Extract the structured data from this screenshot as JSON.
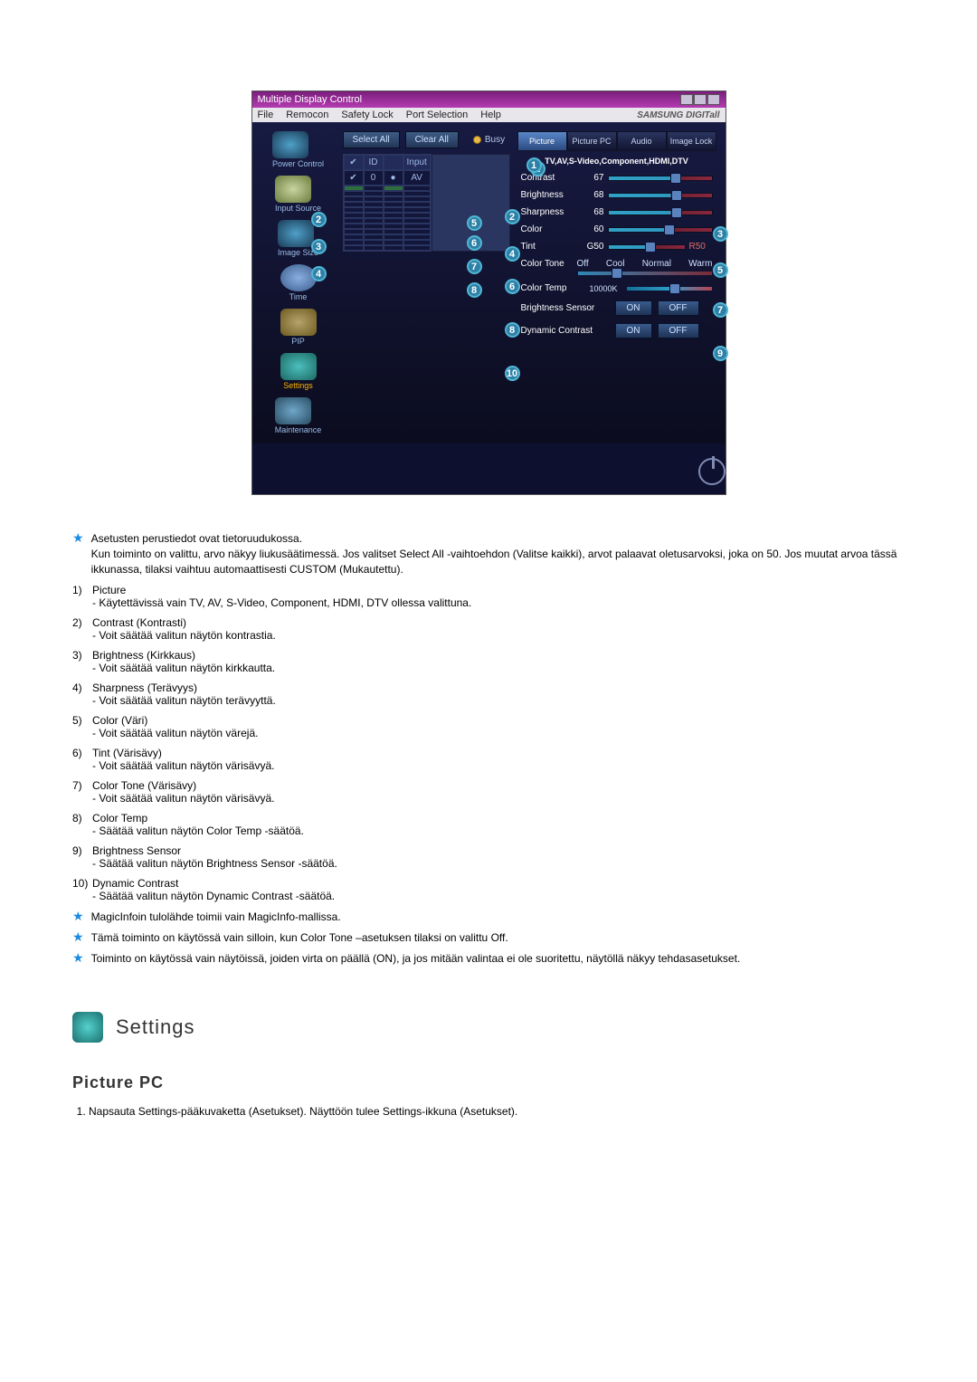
{
  "window": {
    "title": "Multiple Display Control",
    "menus": [
      "File",
      "Remocon",
      "Safety Lock",
      "Port Selection",
      "Help"
    ],
    "brand": "SAMSUNG DIGITall"
  },
  "sidebar": {
    "items": [
      {
        "label": "Power Control"
      },
      {
        "label": "Input Source"
      },
      {
        "label": "Image Size"
      },
      {
        "label": "Time"
      },
      {
        "label": "PIP"
      },
      {
        "label": "Settings",
        "active": true
      },
      {
        "label": "Maintenance"
      }
    ]
  },
  "mid": {
    "select_all": "Select All",
    "clear_all": "Clear All",
    "busy": "Busy",
    "head": {
      "chk": "✔",
      "id": "ID",
      "stat": "",
      "input": "Input"
    },
    "rows": [
      {
        "chk": "✔",
        "id": "0",
        "stat": "●",
        "input": "AV"
      },
      {
        "chk": "",
        "id": "",
        "stat": "",
        "input": ""
      },
      {
        "chk": "",
        "id": "",
        "stat": "",
        "input": ""
      },
      {
        "chk": "",
        "id": "",
        "stat": "",
        "input": ""
      },
      {
        "chk": "",
        "id": "",
        "stat": "",
        "input": ""
      },
      {
        "chk": "",
        "id": "",
        "stat": "",
        "input": ""
      },
      {
        "chk": "",
        "id": "",
        "stat": "",
        "input": ""
      },
      {
        "chk": "",
        "id": "",
        "stat": "",
        "input": ""
      },
      {
        "chk": "",
        "id": "",
        "stat": "",
        "input": ""
      },
      {
        "chk": "",
        "id": "",
        "stat": "",
        "input": ""
      },
      {
        "chk": "",
        "id": "",
        "stat": "",
        "input": ""
      },
      {
        "chk": "",
        "id": "",
        "stat": "",
        "input": ""
      },
      {
        "chk": "",
        "id": "",
        "stat": "",
        "input": ""
      }
    ]
  },
  "right": {
    "tabs": [
      "Picture",
      "Picture PC",
      "Audio",
      "Image Lock"
    ],
    "subhead": "TV,AV,S-Video,Component,HDMI,DTV",
    "contrast": {
      "label": "Contrast",
      "value": "67"
    },
    "brightness": {
      "label": "Brightness",
      "value": "68"
    },
    "sharpness": {
      "label": "Sharpness",
      "value": "68"
    },
    "color": {
      "label": "Color",
      "value": "60"
    },
    "tint": {
      "label": "Tint",
      "left": "G50",
      "right": "R50"
    },
    "color_tone": {
      "label": "Color Tone",
      "opts": [
        "Off",
        "Cool",
        "Normal",
        "Warm"
      ]
    },
    "color_temp": {
      "label": "Color Temp",
      "value": "10000K"
    },
    "brightness_sensor": {
      "label": "Brightness Sensor",
      "on": "ON",
      "off": "OFF"
    },
    "dynamic_contrast": {
      "label": "Dynamic Contrast",
      "on": "ON",
      "off": "OFF"
    }
  },
  "callouts": [
    "1",
    "2",
    "3",
    "4",
    "5",
    "6",
    "7",
    "8",
    "9",
    "10"
  ],
  "notes": {
    "star1_a": "Asetusten perustiedot ovat tietoruudukossa.",
    "star1_b": "Kun toiminto on valittu, arvo näkyy liukusäätimessä. Jos valitset Select All -vaihtoehdon (Valitse kaikki), arvot palaavat oletusarvoksi, joka on 50. Jos muutat arvoa tässä ikkunassa, tilaksi vaihtuu automaattisesti CUSTOM (Mukautettu).",
    "items": [
      {
        "n": "1)",
        "t": "Picture",
        "d": "- Käytettävissä vain TV, AV, S-Video, Component, HDMI, DTV ollessa valittuna."
      },
      {
        "n": "2)",
        "t": "Contrast (Kontrasti)",
        "d": "- Voit säätää valitun näytön kontrastia."
      },
      {
        "n": "3)",
        "t": "Brightness (Kirkkaus)",
        "d": "- Voit säätää valitun näytön kirkkautta."
      },
      {
        "n": "4)",
        "t": "Sharpness (Terävyys)",
        "d": "- Voit säätää valitun näytön terävyyttä."
      },
      {
        "n": "5)",
        "t": "Color (Väri)",
        "d": "- Voit säätää valitun näytön värejä."
      },
      {
        "n": "6)",
        "t": "Tint (Värisävy)",
        "d": "- Voit säätää valitun näytön värisävyä."
      },
      {
        "n": "7)",
        "t": "Color Tone (Värisävy)",
        "d": "- Voit säätää valitun näytön värisävyä."
      },
      {
        "n": "8)",
        "t": "Color Temp",
        "d": "- Säätää valitun näytön Color Temp -säätöä."
      },
      {
        "n": "9)",
        "t": "Brightness Sensor",
        "d": "- Säätää valitun näytön Brightness Sensor -säätöä."
      },
      {
        "n": "10)",
        "t": "Dynamic Contrast",
        "d": "- Säätää valitun näytön Dynamic Contrast -säätöä."
      }
    ],
    "star2": "MagicInfoin tulolähde toimii vain MagicInfo-mallissa.",
    "star3": "Tämä toiminto on käytössä vain silloin, kun Color Tone –asetuksen tilaksi on valittu Off.",
    "star4": "Toiminto on käytössä vain näytöissä, joiden virta on päällä (ON), ja jos mitään valintaa ei ole suoritettu, näytöllä näkyy tehdasasetukset."
  },
  "section": {
    "title": "Settings",
    "sub": "Picture PC"
  },
  "steps": {
    "s1": "Napsauta Settings-pääkuvaketta (Asetukset). Näyttöön tulee Settings-ikkuna (Asetukset)."
  }
}
